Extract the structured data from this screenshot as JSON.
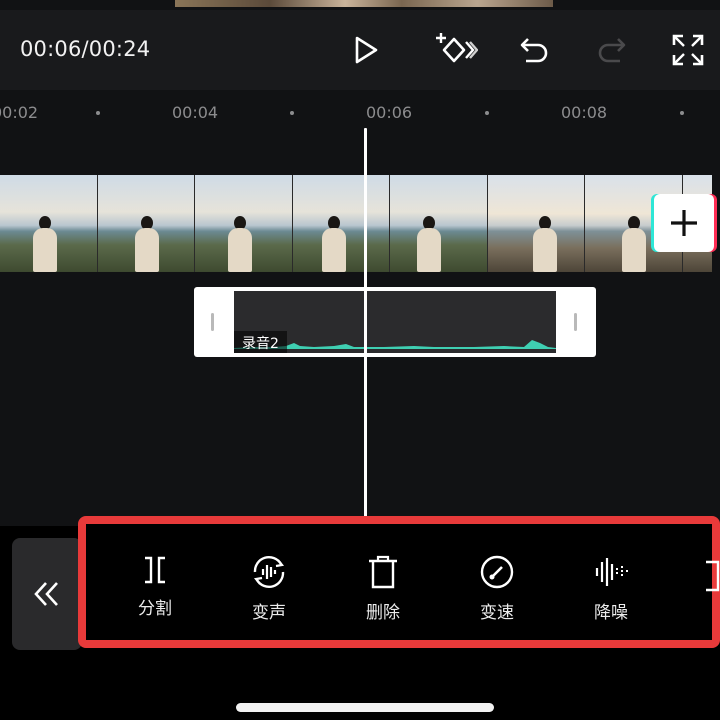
{
  "player": {
    "time_display": "00:06/00:24"
  },
  "ruler": {
    "ticks": [
      "00:02",
      "00:04",
      "00:06",
      "00:08"
    ]
  },
  "tracks": {
    "audio_label": "录音2"
  },
  "toolbar": {
    "items": [
      {
        "label": "分割",
        "icon": "split-icon"
      },
      {
        "label": "变声",
        "icon": "voice-change-icon"
      },
      {
        "label": "删除",
        "icon": "delete-icon"
      },
      {
        "label": "变速",
        "icon": "speed-icon"
      },
      {
        "label": "降噪",
        "icon": "noise-reduction-icon"
      }
    ]
  },
  "colors": {
    "highlight_border": "#e83a3a",
    "waveform": "#3fcfb2"
  }
}
